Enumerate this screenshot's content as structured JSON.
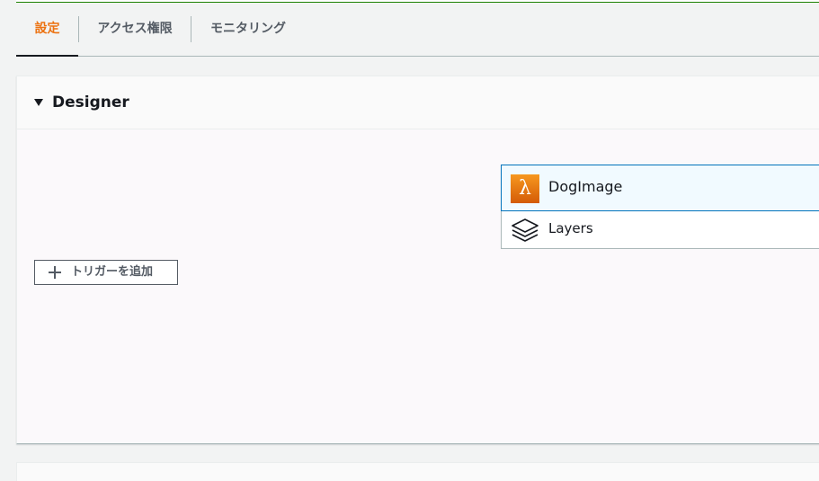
{
  "tabs": [
    {
      "label": "設定",
      "active": true
    },
    {
      "label": "アクセス権限",
      "active": false
    },
    {
      "label": "モニタリング",
      "active": false
    }
  ],
  "designer": {
    "title": "Designer",
    "add_trigger_label": "トリガーを追加",
    "function_name": "DogImage",
    "layers_label": "Layers"
  },
  "icons": {
    "lambda": "lambda-icon",
    "layers": "layers-icon",
    "plus": "plus-icon",
    "caret": "caret-down-icon"
  },
  "colors": {
    "active_tab": "#ec7211",
    "selection_border": "#0073bb",
    "lambda_orange": "#f7981f"
  }
}
